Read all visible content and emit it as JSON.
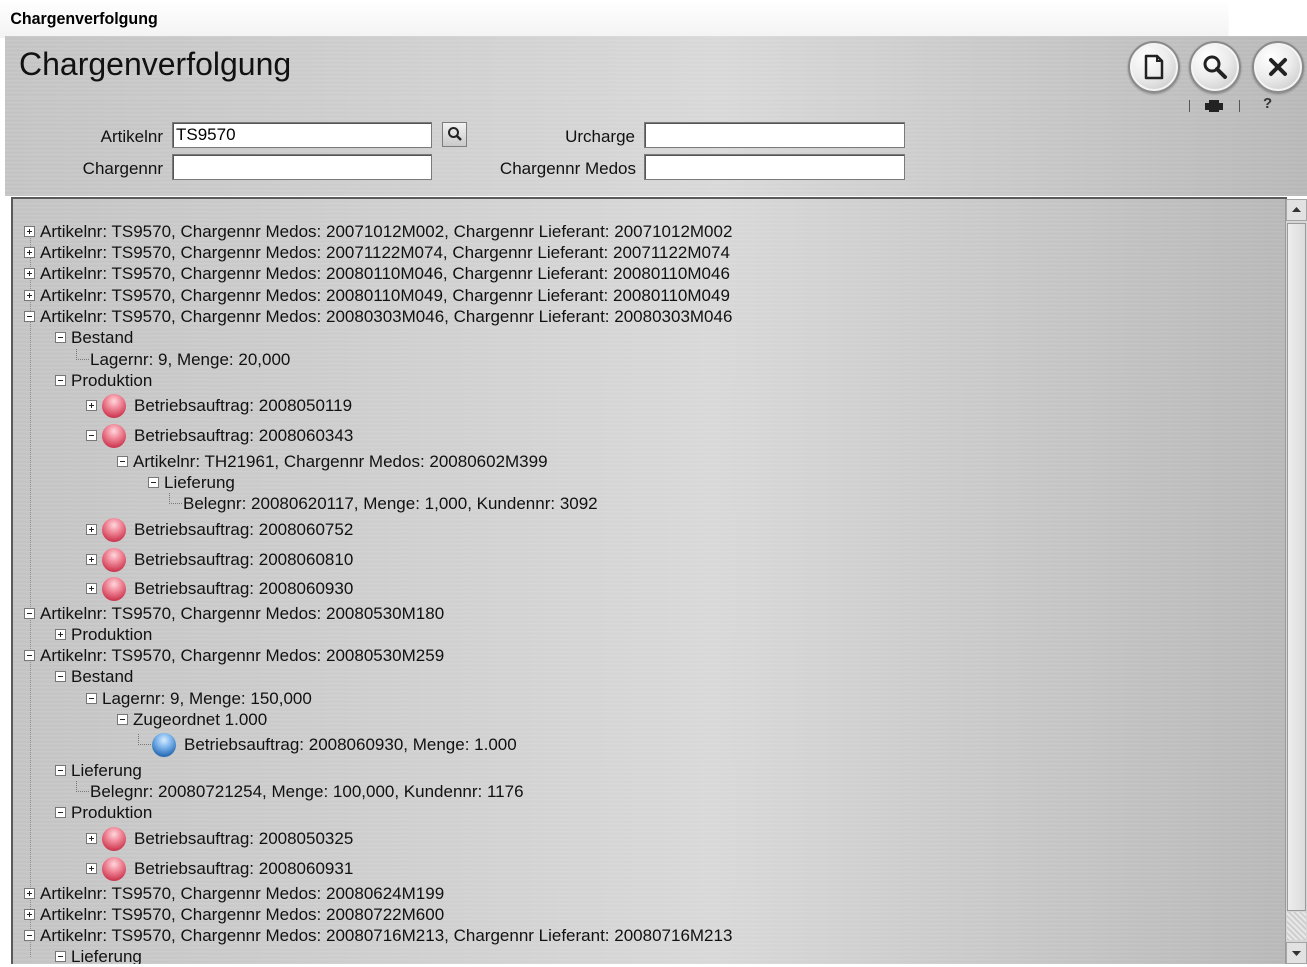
{
  "window": {
    "title": "Chargenverfolgung"
  },
  "header": {
    "title": "Chargenverfolgung",
    "buttons": [
      {
        "name": "new-document-button",
        "icon": "document-icon"
      },
      {
        "name": "search-button",
        "icon": "magnifier-icon"
      },
      {
        "name": "close-button",
        "icon": "close-icon"
      }
    ],
    "sub_toolbar_icons": [
      "printer-icon",
      "help-icon"
    ]
  },
  "search": {
    "artikelnr_label": "Artikelnr",
    "artikelnr_value": "TS9570",
    "chargennr_label": "Chargennr",
    "chargennr_value": "",
    "urcharge_label": "Urcharge",
    "urcharge_value": "",
    "chargennr_medos_label": "Chargennr Medos",
    "chargennr_medos_value": ""
  },
  "tree": [
    {
      "level": 0,
      "toggle": "plus",
      "text": "Artikelnr: TS9570, Chargennr Medos: 20071012M002, Chargennr Lieferant: 20071012M002"
    },
    {
      "level": 0,
      "toggle": "plus",
      "text": "Artikelnr: TS9570, Chargennr Medos: 20071122M074, Chargennr Lieferant: 20071122M074"
    },
    {
      "level": 0,
      "toggle": "plus",
      "text": "Artikelnr: TS9570, Chargennr Medos: 20080110M046, Chargennr Lieferant: 20080110M046"
    },
    {
      "level": 0,
      "toggle": "plus",
      "text": "Artikelnr: TS9570, Chargennr Medos: 20080110M049, Chargennr Lieferant: 20080110M049"
    },
    {
      "level": 0,
      "toggle": "minus",
      "text": "Artikelnr: TS9570, Chargennr Medos: 20080303M046, Chargennr Lieferant: 20080303M046"
    },
    {
      "level": 1,
      "toggle": "minus",
      "text": "Bestand"
    },
    {
      "level": 2,
      "toggle": "leaf",
      "text": "Lagernr: 9, Menge: 20,000"
    },
    {
      "level": 1,
      "toggle": "minus",
      "text": "Produktion"
    },
    {
      "level": 2,
      "toggle": "plus",
      "icon": "red",
      "text": "Betriebsauftrag: 2008050119"
    },
    {
      "level": 2,
      "toggle": "minus",
      "icon": "red",
      "text": "Betriebsauftrag: 2008060343"
    },
    {
      "level": 3,
      "toggle": "minus",
      "text": "Artikelnr: TH21961, Chargennr Medos: 20080602M399"
    },
    {
      "level": 4,
      "toggle": "minus",
      "text": "Lieferung"
    },
    {
      "level": 5,
      "toggle": "leaf",
      "text": "Belegnr: 20080620117, Menge: 1,000, Kundennr: 3092"
    },
    {
      "level": 2,
      "toggle": "plus",
      "icon": "red",
      "text": "Betriebsauftrag: 2008060752"
    },
    {
      "level": 2,
      "toggle": "plus",
      "icon": "red",
      "text": "Betriebsauftrag: 2008060810"
    },
    {
      "level": 2,
      "toggle": "plus",
      "icon": "red",
      "text": "Betriebsauftrag: 2008060930"
    },
    {
      "level": 0,
      "toggle": "minus",
      "text": "Artikelnr: TS9570, Chargennr Medos: 20080530M180"
    },
    {
      "level": 1,
      "toggle": "plus",
      "text": "Produktion"
    },
    {
      "level": 0,
      "toggle": "minus",
      "text": "Artikelnr: TS9570, Chargennr Medos: 20080530M259"
    },
    {
      "level": 1,
      "toggle": "minus",
      "text": "Bestand"
    },
    {
      "level": 2,
      "toggle": "minus",
      "text": "Lagernr: 9, Menge: 150,000"
    },
    {
      "level": 3,
      "toggle": "minus",
      "text": "Zugeordnet 1.000"
    },
    {
      "level": 4,
      "toggle": "leaf",
      "icon": "blue",
      "text": "Betriebsauftrag: 2008060930, Menge: 1.000"
    },
    {
      "level": 1,
      "toggle": "minus",
      "text": "Lieferung"
    },
    {
      "level": 2,
      "toggle": "leaf",
      "text": "Belegnr: 20080721254, Menge: 100,000, Kundennr: 1176"
    },
    {
      "level": 1,
      "toggle": "minus",
      "text": "Produktion"
    },
    {
      "level": 2,
      "toggle": "plus",
      "icon": "red",
      "text": "Betriebsauftrag: 2008050325"
    },
    {
      "level": 2,
      "toggle": "plus",
      "icon": "red",
      "text": "Betriebsauftrag: 2008060931"
    },
    {
      "level": 0,
      "toggle": "plus",
      "text": "Artikelnr: TS9570, Chargennr Medos: 20080624M199"
    },
    {
      "level": 0,
      "toggle": "plus",
      "text": "Artikelnr: TS9570, Chargennr Medos: 20080722M600"
    },
    {
      "level": 0,
      "toggle": "minus",
      "text": "Artikelnr: TS9570, Chargennr Medos: 20080716M213, Chargennr Lieferant: 20080716M213"
    },
    {
      "level": 1,
      "toggle": "minus",
      "text": "Lieferung"
    }
  ],
  "colors": {
    "ball_red": "#d03d55",
    "ball_blue": "#2e6fb8",
    "panel": "#c4c4c4"
  }
}
